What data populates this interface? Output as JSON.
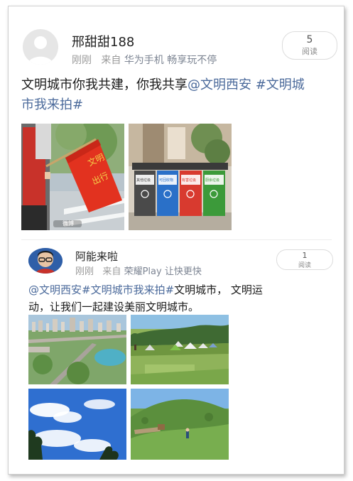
{
  "post1": {
    "username": "邢甜甜188",
    "time": "刚刚",
    "from_prefix": "来自",
    "source": "华为手机 畅享玩不停",
    "read_count": "5",
    "read_label": "阅读",
    "text_line1_plain": "文明城市你我共建，你我共享",
    "mention": "@文明西安",
    "hashtag_part1": " #文明城",
    "hashtag_part2": "市我来拍#",
    "image1_flag_text": "文明出行",
    "image2_bin_labels": [
      "其他垃圾",
      "可回收物",
      "有害垃圾",
      "厨余垃圾"
    ],
    "image1_watermark": "微博"
  },
  "post2": {
    "username": "阿能来啦",
    "time": "刚刚",
    "from_prefix": "来自",
    "source": "荣耀Play 让快更快",
    "read_count": "1",
    "read_label": "阅读",
    "line1_tags": "@文明西安#文明城市我来拍#",
    "line1_plain": "文明城市，  文明运",
    "line2_plain": "动，让我们一起建设美丽文明城市。"
  },
  "colors": {
    "link": "#4b6a9b",
    "flag_red": "#e2321f",
    "bin_gray": "#4a4a4a",
    "bin_blue": "#2a70c8",
    "bin_red": "#d83a2f",
    "bin_green": "#3c9a3a"
  }
}
